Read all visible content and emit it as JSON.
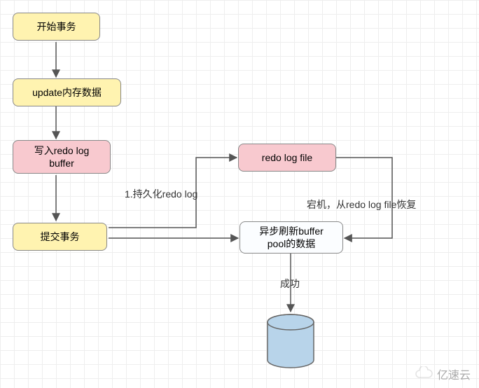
{
  "nodes": {
    "start": "开始事务",
    "update": "update内存数据",
    "writeRedo": "写入redo log\nbuffer",
    "commit": "提交事务",
    "redoFile": "redo log file",
    "asyncFlush": "异步刷新buffer\npool的数据"
  },
  "labels": {
    "persist": "1.持久化redo log",
    "recover": "宕机，从redo log file恢复",
    "success": "成功"
  },
  "watermark": "亿速云",
  "chart_data": {
    "type": "flowchart",
    "title": "",
    "nodes": [
      {
        "id": "start",
        "label": "开始事务",
        "shape": "rounded-rect",
        "style": "yellow"
      },
      {
        "id": "update",
        "label": "update内存数据",
        "shape": "rounded-rect",
        "style": "yellow"
      },
      {
        "id": "writeRedo",
        "label": "写入redo log buffer",
        "shape": "rounded-rect",
        "style": "pink"
      },
      {
        "id": "commit",
        "label": "提交事务",
        "shape": "rounded-rect",
        "style": "yellow"
      },
      {
        "id": "redoFile",
        "label": "redo log file",
        "shape": "rounded-rect",
        "style": "pink"
      },
      {
        "id": "asyncFlush",
        "label": "异步刷新buffer pool的数据",
        "shape": "rounded-rect",
        "style": "blue"
      },
      {
        "id": "db",
        "label": "",
        "shape": "cylinder",
        "style": "blue-db"
      }
    ],
    "edges": [
      {
        "from": "start",
        "to": "update",
        "label": ""
      },
      {
        "from": "update",
        "to": "writeRedo",
        "label": ""
      },
      {
        "from": "writeRedo",
        "to": "commit",
        "label": ""
      },
      {
        "from": "commit",
        "to": "redoFile",
        "label": "1.持久化redo log"
      },
      {
        "from": "commit",
        "to": "asyncFlush",
        "label": ""
      },
      {
        "from": "asyncFlush",
        "to": "db",
        "label": "成功"
      },
      {
        "from": "redoFile",
        "to": "asyncFlush",
        "label": "宕机，从redo log file恢复",
        "routing": "right-side"
      }
    ]
  }
}
